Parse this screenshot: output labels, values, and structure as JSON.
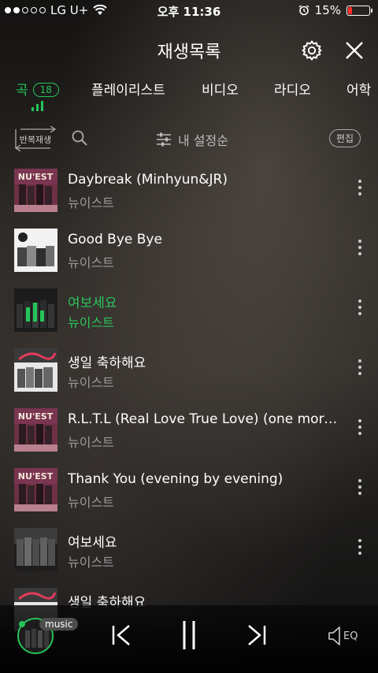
{
  "status_bar": {
    "carrier": "LG U+",
    "time": "오후 11:36",
    "battery": "15%"
  },
  "header": {
    "title": "재생목록"
  },
  "tabs": [
    {
      "label": "곡",
      "count": "18",
      "active": true
    },
    {
      "label": "플레이리스트"
    },
    {
      "label": "비디오"
    },
    {
      "label": "라디오"
    },
    {
      "label": "어학"
    }
  ],
  "toolbar": {
    "repeat_label": "반복재생",
    "sort_label": "내 설정순",
    "edit_label": "편집"
  },
  "songs": [
    {
      "title": "Daybreak (Minhyun&JR)",
      "artist": "뉴이스트"
    },
    {
      "title": "Good Bye Bye",
      "artist": "뉴이스트"
    },
    {
      "title": "여보세요",
      "artist": "뉴이스트",
      "playing": true
    },
    {
      "title": "생일 축하해요",
      "artist": "뉴이스트"
    },
    {
      "title": "R.L.T.L (Real Love True Love) (one morn...",
      "artist": "뉴이스트"
    },
    {
      "title": "Thank You (evening by evening)",
      "artist": "뉴이스트"
    },
    {
      "title": "여보세요",
      "artist": "뉴이스트"
    },
    {
      "title": "생일 축하해요",
      "artist": ""
    }
  ],
  "player": {
    "badge": "music",
    "eq_label": "EQ"
  },
  "colors": {
    "accent": "#25c45a",
    "battery_low": "#ff2d2d"
  }
}
